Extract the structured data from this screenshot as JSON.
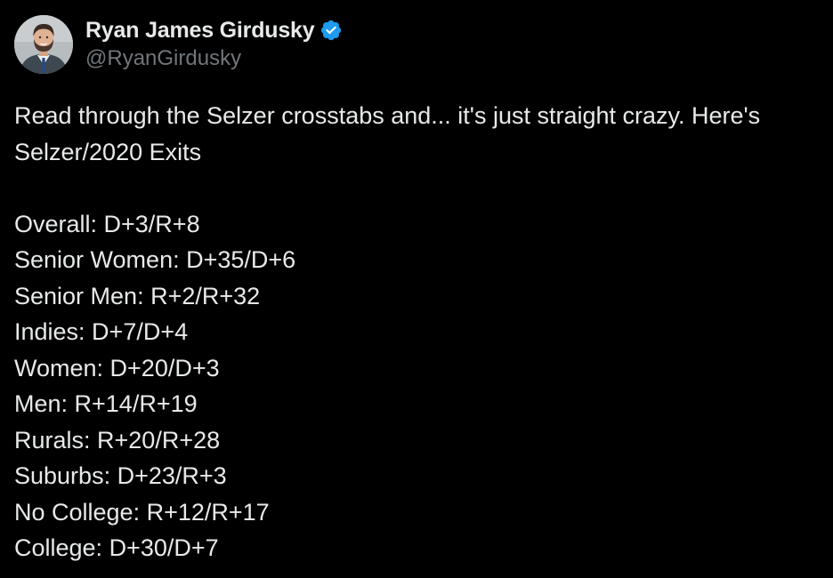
{
  "author": {
    "display_name": "Ryan James Girdusky",
    "handle": "@RyanGirdusky",
    "verified_icon": "verified-badge-icon",
    "verified_color": "#1d9bf0"
  },
  "tweet": {
    "intro": "Read through the Selzer crosstabs and... it's just straight crazy. Here's Selzer/2020 Exits",
    "lines": [
      "Overall: D+3/R+8",
      "Senior Women: D+35/D+6",
      "Senior Men: R+2/R+32",
      "Indies: D+7/D+4",
      "Women: D+20/D+3",
      "Men: R+14/R+19",
      "Rurals: R+20/R+28",
      "Suburbs: D+23/R+3",
      "No College: R+12/R+17",
      "College: D+30/D+7"
    ]
  },
  "theme": {
    "background": "#000000",
    "text": "#e7e9ea",
    "muted": "#71767b"
  }
}
